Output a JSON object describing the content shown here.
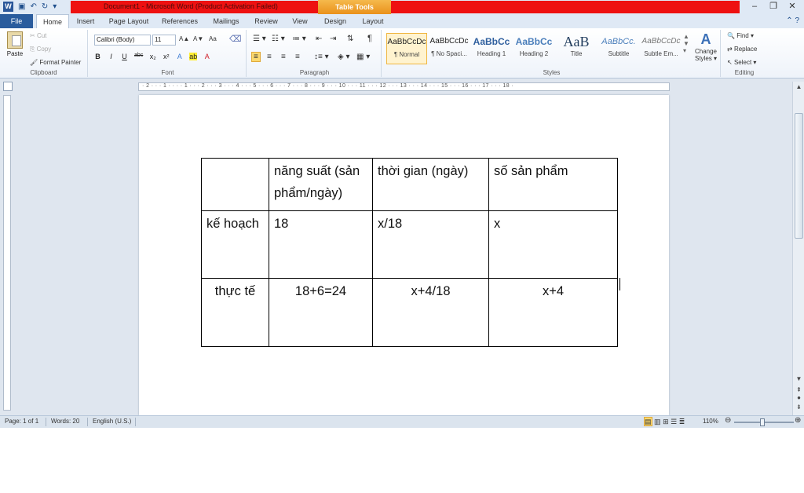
{
  "window": {
    "title": "Document1  -  Microsoft Word (Product Activation Failed)",
    "contextual_tab_group": "Table Tools",
    "app_icon": "W",
    "accent_red": "#ee1111",
    "accent_orange": "#e98f18",
    "file_tab_color": "#2a5c9d"
  },
  "qat": {
    "save_icon": "save-icon",
    "undo_icon": "undo-icon",
    "redo_icon": "redo-icon"
  },
  "tabs": [
    "File",
    "Home",
    "Insert",
    "Page Layout",
    "References",
    "Mailings",
    "Review",
    "View",
    "Design",
    "Layout"
  ],
  "active_tab": "Home",
  "clipboard": {
    "paste": "Paste",
    "cut": "Cut",
    "copy": "Copy",
    "format_painter": "Format Painter",
    "label": "Clipboard"
  },
  "font": {
    "name": "Calibri (Body)",
    "size": "11",
    "label": "Font",
    "bold": "B",
    "italic": "I",
    "underline": "U",
    "strike": "abc",
    "subscript": "x₂",
    "superscript": "x²",
    "grow": "A▲",
    "shrink": "A▼",
    "case": "Aa"
  },
  "paragraph": {
    "label": "Paragraph",
    "pilcrow": "¶"
  },
  "styles": {
    "label": "Styles",
    "items": [
      {
        "sample": "AaBbCcDc",
        "name": "¶ Normal"
      },
      {
        "sample": "AaBbCcDc",
        "name": "¶ No Spaci..."
      },
      {
        "sample": "AaBbCc",
        "name": "Heading 1"
      },
      {
        "sample": "AaBbCc",
        "name": "Heading 2"
      },
      {
        "sample": "AaB",
        "name": "Title"
      },
      {
        "sample": "AaBbCc.",
        "name": "Subtitle"
      },
      {
        "sample": "AaBbCcDc",
        "name": "Subtle Em..."
      }
    ],
    "change_styles": "Change Styles ▾"
  },
  "editing": {
    "label": "Editing",
    "find": "Find ▾",
    "replace": "Replace",
    "select": "Select ▾"
  },
  "ruler_numbers": "· 2 · · · 1 · · · · 1 · · · 2 · · · 3 · · · 4 · · · 5 · · · 6 · · · 7 · · · 8 · · · 9 · · · 10 · · · 11 · · · 12 · · · 13 · · · 14 · · · 15 · · · 16 · · · 17 · · · 18 ·",
  "table": {
    "rows": [
      [
        "",
        "năng suất (sản phẩm/ngày)",
        "thời gian (ngày)",
        "số sản phẩm"
      ],
      [
        "kế hoạch",
        "18",
        "x/18",
        "x"
      ],
      [
        "thực tế",
        "18+6=24",
        "x+4/18",
        "x+4"
      ]
    ]
  },
  "status": {
    "page": "Page: 1 of 1",
    "words": "Words: 20",
    "language": "English (U.S.)",
    "zoom": "110%",
    "zoom_level": 1.1
  }
}
